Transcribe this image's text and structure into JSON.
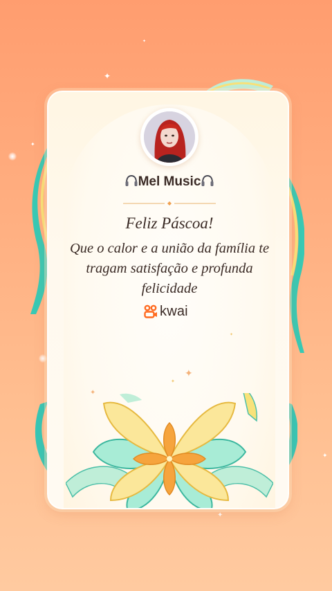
{
  "card": {
    "username": "Mel Music",
    "greeting_title": "Feliz Páscoa!",
    "greeting_message": "Que o calor e a união da família te tragam satisfação e profunda felicidade",
    "brand_label": "kwai"
  },
  "colors": {
    "background_top": "#ff9d6f",
    "background_bottom": "#ffcaa0",
    "card": "#fff9ee",
    "text": "#3a2a25",
    "brand_orange": "#ff6a1f",
    "ribbon_teal": "#34c7b6",
    "ribbon_yellow": "#f8e27a",
    "petal_orange": "#f6a43d"
  },
  "icons": {
    "headset_left": "headphones-icon",
    "headset_right": "headphones-icon",
    "brand": "kwai-logo-icon"
  }
}
